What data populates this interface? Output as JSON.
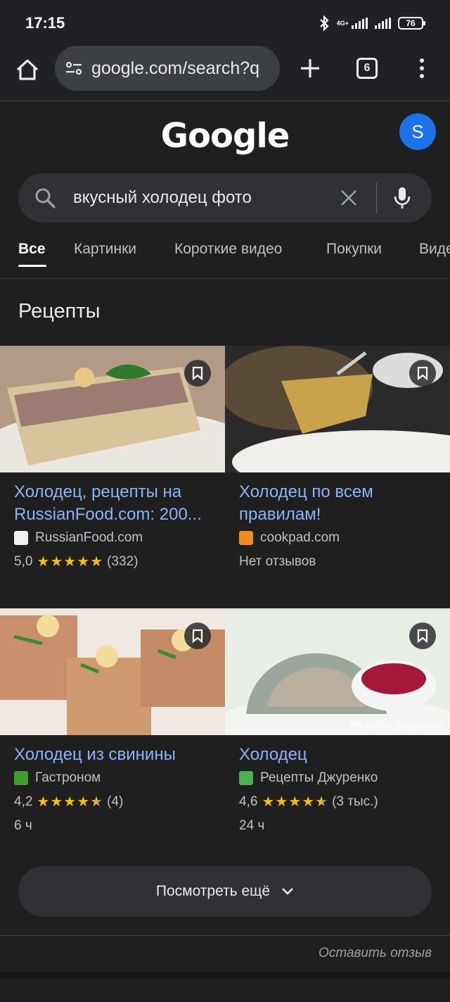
{
  "status_bar": {
    "time": "17:15",
    "network": "4G+",
    "battery": "76"
  },
  "browser": {
    "url": "google.com/search?q",
    "tab_count": "6"
  },
  "google": {
    "logo": "Google",
    "avatar_letter": "S"
  },
  "search": {
    "query": "вкусный холодец фото"
  },
  "tabs": [
    "Все",
    "Картинки",
    "Короткие видео",
    "Покупки",
    "Видео"
  ],
  "recipes": {
    "heading": "Рецепты",
    "items": [
      {
        "title": "Холодец, рецепты на RussianFood.com: 200...",
        "source": "RussianFood.com",
        "rating": "5,0",
        "stars": 5,
        "reviews": "(332)",
        "meta": ""
      },
      {
        "title": "Холодец по всем правилам!",
        "source": "cookpad.com",
        "rating": "",
        "stars": 0,
        "reviews": "",
        "no_reviews": "Нет отзывов",
        "meta": ""
      },
      {
        "title": "Холодец из свинины",
        "source": "Гастроном",
        "rating": "4,2",
        "stars": 4.5,
        "reviews": "(4)",
        "meta": "6 ч"
      },
      {
        "title": "Холодец",
        "source": "Рецепты Джуренко",
        "rating": "4,6",
        "stars": 4.5,
        "reviews": "(3 тыс.)",
        "meta": "24 ч",
        "image_watermark": "Рецепты Джуренко"
      }
    ],
    "more_label": "Посмотреть ещё"
  },
  "footer": {
    "feedback": "Оставить отзыв"
  },
  "colors": {
    "background": "#1f1f1f",
    "link": "#8ab4f8",
    "star": "#fbbc04",
    "avatar": "#1a73e8"
  }
}
